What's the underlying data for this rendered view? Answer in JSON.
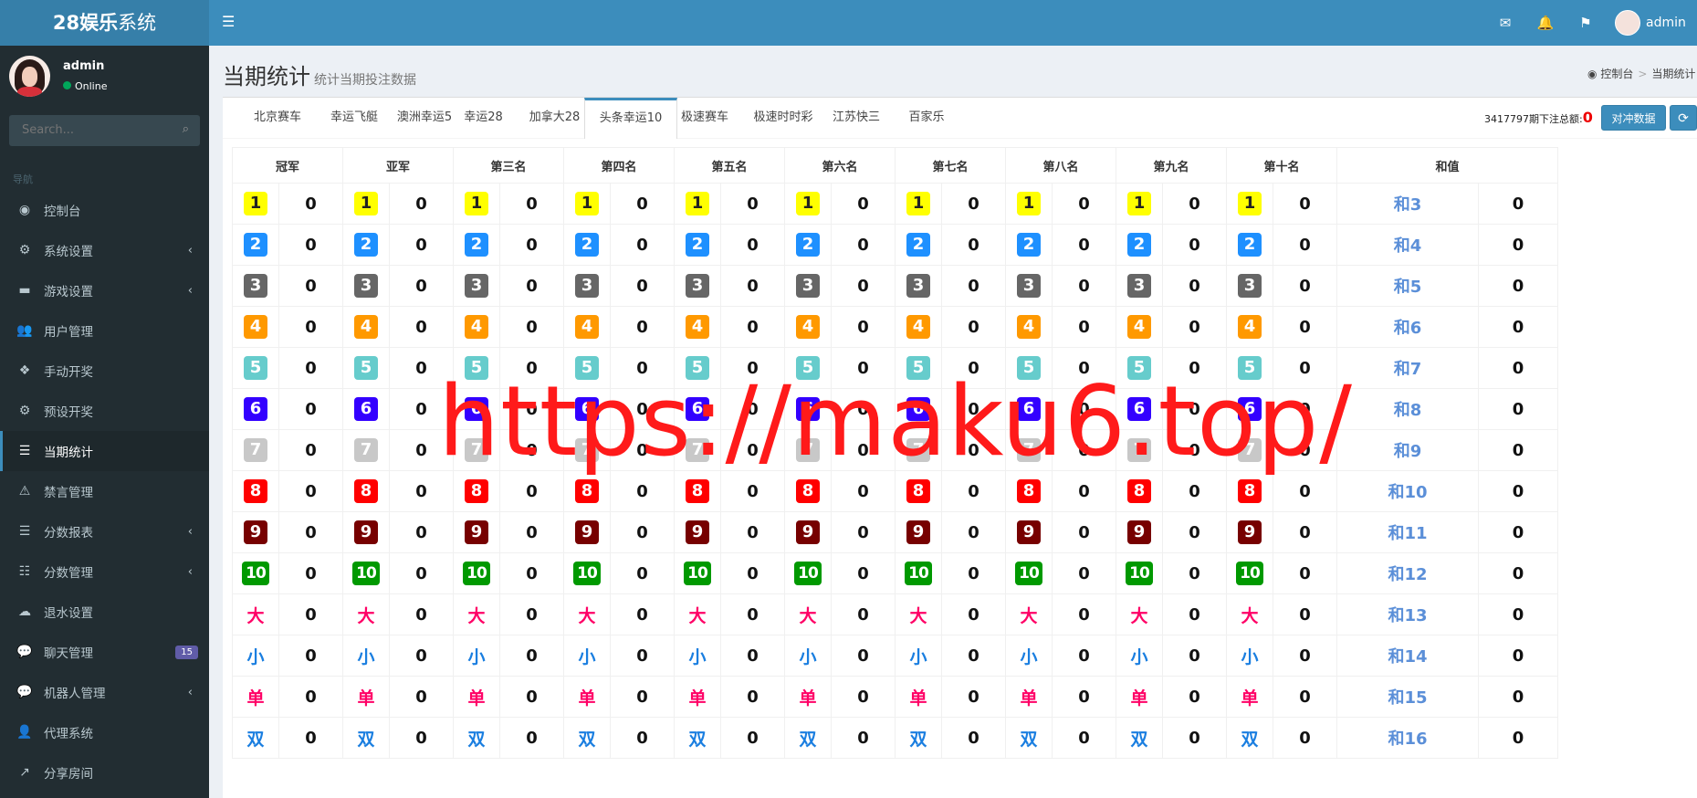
{
  "logo": {
    "bold": "28娱乐",
    "rest": "系统"
  },
  "navbar": {
    "username": "admin"
  },
  "sidebar": {
    "username": "admin",
    "status": "Online",
    "search_placeholder": "Search...",
    "nav_header": "导航",
    "items": [
      {
        "label": "控制台",
        "icon": "dashboard-icon",
        "glyph": "◉",
        "chevron": false
      },
      {
        "label": "系统设置",
        "icon": "cogs-icon",
        "glyph": "⚙",
        "chevron": true
      },
      {
        "label": "游戏设置",
        "icon": "gamepad-icon",
        "glyph": "▬",
        "chevron": true
      },
      {
        "label": "用户管理",
        "icon": "users-icon",
        "glyph": "👥",
        "chevron": false
      },
      {
        "label": "手动开奖",
        "icon": "cubes-icon",
        "glyph": "❖",
        "chevron": false
      },
      {
        "label": "预设开奖",
        "icon": "cog-icon",
        "glyph": "⚙",
        "chevron": false
      },
      {
        "label": "当期统计",
        "icon": "list-icon",
        "glyph": "☰",
        "chevron": false,
        "active": true
      },
      {
        "label": "禁言管理",
        "icon": "warning-icon",
        "glyph": "⚠",
        "chevron": false
      },
      {
        "label": "分数报表",
        "icon": "list-ul-icon",
        "glyph": "☰",
        "chevron": true
      },
      {
        "label": "分数管理",
        "icon": "database-icon",
        "glyph": "☷",
        "chevron": true
      },
      {
        "label": "退水设置",
        "icon": "cloud-upload-icon",
        "glyph": "☁",
        "chevron": false
      },
      {
        "label": "聊天管理",
        "icon": "comments-icon",
        "glyph": "💬",
        "chevron": false,
        "badge": "15"
      },
      {
        "label": "机器人管理",
        "icon": "commenting-icon",
        "glyph": "💬",
        "chevron": true
      },
      {
        "label": "代理系统",
        "icon": "user-plus-icon",
        "glyph": "👤",
        "chevron": false
      },
      {
        "label": "分享房间",
        "icon": "share-icon",
        "glyph": "↗",
        "chevron": false
      }
    ]
  },
  "header": {
    "title": "当期统计",
    "subtitle": "统计当期投注数据"
  },
  "breadcrumb": {
    "home": "控制台",
    "current": "当期统计"
  },
  "tabs": [
    "北京赛车",
    "幸运飞艇",
    "澳洲幸运5",
    "幸运28",
    "加拿大28",
    "头条幸运10",
    "极速赛车",
    "极速时时彩",
    "江苏快三",
    "百家乐"
  ],
  "active_tab": 5,
  "period": {
    "id": "3417797",
    "label": "期下注总额:",
    "amount": "0"
  },
  "buttons": {
    "hedge": "对冲数据"
  },
  "table": {
    "columns": [
      "冠军",
      "亚军",
      "第三名",
      "第四名",
      "第五名",
      "第六名",
      "第七名",
      "第八名",
      "第九名",
      "第十名",
      "和值"
    ],
    "rows": [
      {
        "item": "1",
        "sum": "和3"
      },
      {
        "item": "2",
        "sum": "和4"
      },
      {
        "item": "3",
        "sum": "和5"
      },
      {
        "item": "4",
        "sum": "和6"
      },
      {
        "item": "5",
        "sum": "和7"
      },
      {
        "item": "6",
        "sum": "和8"
      },
      {
        "item": "7",
        "sum": "和9"
      },
      {
        "item": "8",
        "sum": "和10"
      },
      {
        "item": "9",
        "sum": "和11"
      },
      {
        "item": "10",
        "sum": "和12"
      },
      {
        "item": "大",
        "sum": "和13"
      },
      {
        "item": "小",
        "sum": "和14"
      },
      {
        "item": "单",
        "sum": "和15"
      },
      {
        "item": "双",
        "sum": "和16"
      }
    ],
    "value": "0"
  },
  "colors": {
    "1": "#ffff00",
    "2": "#1e90ff",
    "3": "#666666",
    "4": "#ff9900",
    "5": "#66cccc",
    "6": "#3300ff",
    "7": "#c8c8c8",
    "8": "#ff0000",
    "9": "#770000",
    "10": "#009900",
    "大": "#ff0066",
    "小": "#1a7ee0",
    "单": "#ff0066",
    "双": "#1a7ee0"
  },
  "watermark": "https://maku6.top/"
}
